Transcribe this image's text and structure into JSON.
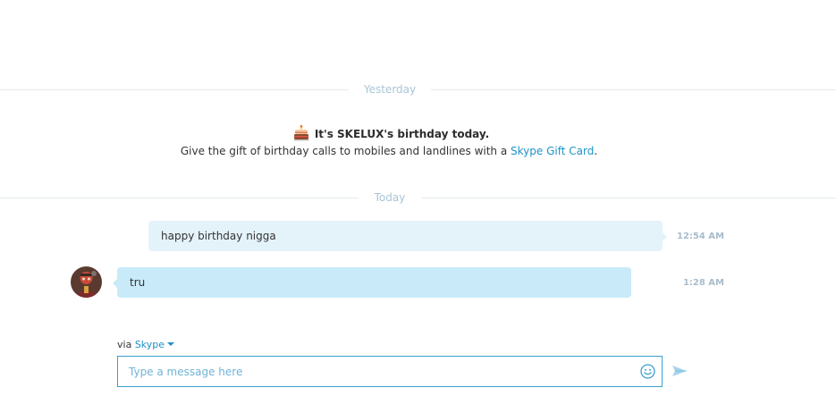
{
  "separators": {
    "yesterday": "Yesterday",
    "today": "Today"
  },
  "birthday": {
    "title": "It's SKELUX's birthday today.",
    "desc_prefix": "Give the gift of birthday calls to mobiles and landlines with a ",
    "link": "Skype Gift Card",
    "desc_suffix": "."
  },
  "messages": [
    {
      "text": "happy birthday nigga",
      "time": "12:54 AM",
      "direction": "outgoing"
    },
    {
      "text": "tru",
      "time": "1:28 AM",
      "direction": "incoming"
    }
  ],
  "composer": {
    "via_prefix": "via",
    "service": "Skype",
    "placeholder": "Type a message here"
  },
  "icons": {
    "cake": "birthday-cake-icon",
    "emoji": "smiley-icon",
    "send": "send-arrow-icon"
  },
  "colors": {
    "accent": "#1e93c8",
    "outgoing_bubble": "#e4f3fa",
    "incoming_bubble": "#c8eaf9",
    "separator_text": "#a9c4d6"
  }
}
